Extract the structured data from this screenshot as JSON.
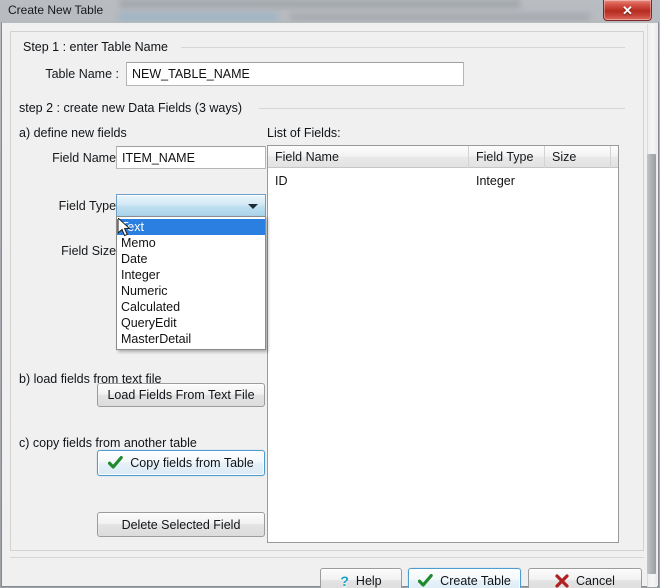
{
  "window": {
    "title": "Create New Table",
    "close_label": "✕"
  },
  "step1": {
    "legend": "Step 1 : enter Table Name",
    "table_name_label": "Table Name :",
    "table_name_value": "NEW_TABLE_NAME",
    "table_name_placeholder": "NEW_TABLE_NAME"
  },
  "step2": {
    "legend": "step 2 : create new Data Fields (3 ways)",
    "section_a": "a) define new fields",
    "section_b": "b) load fields from text file",
    "section_c": "c) copy fields from another table",
    "field_name_label": "Field Name :",
    "field_name_value": "ITEM_NAME",
    "field_name_placeholder": "ITEM_NAME",
    "field_type_label": "Field Type :",
    "field_type_value": "",
    "field_size_label": "Field Size :",
    "field_size_value": "",
    "load_fields_button": "Load Fields From Text File",
    "copy_fields_button": "Copy fields from Table",
    "delete_field_button": "Delete Selected Field"
  },
  "field_type_dropdown": {
    "open": true,
    "selected": "Text",
    "options": [
      "Text",
      "Memo",
      "Date",
      "Integer",
      "Numeric",
      "Calculated",
      "QueryEdit",
      "MasterDetail"
    ]
  },
  "fields_list": {
    "title": "List of Fields:",
    "columns": [
      "Field Name",
      "Field Type",
      "Size"
    ],
    "rows": [
      {
        "name": "ID",
        "type": "Integer",
        "size": ""
      }
    ]
  },
  "footer": {
    "help_button": "Help",
    "create_button": "Create Table",
    "cancel_button": "Cancel"
  },
  "icons": {
    "close": "close-icon",
    "check": "check-icon",
    "cross": "cross-icon",
    "question": "?",
    "chevron_down": "chevron-down-icon",
    "cursor": "mouse-cursor-icon"
  },
  "colors": {
    "accent_blue": "#2a7fe0",
    "close_red": "#b52b1f",
    "check_green": "#1f8a2e",
    "cancel_red": "#b02020",
    "help_cyan": "#1aa3c8",
    "dialog_bg": "#f0f0f0"
  }
}
